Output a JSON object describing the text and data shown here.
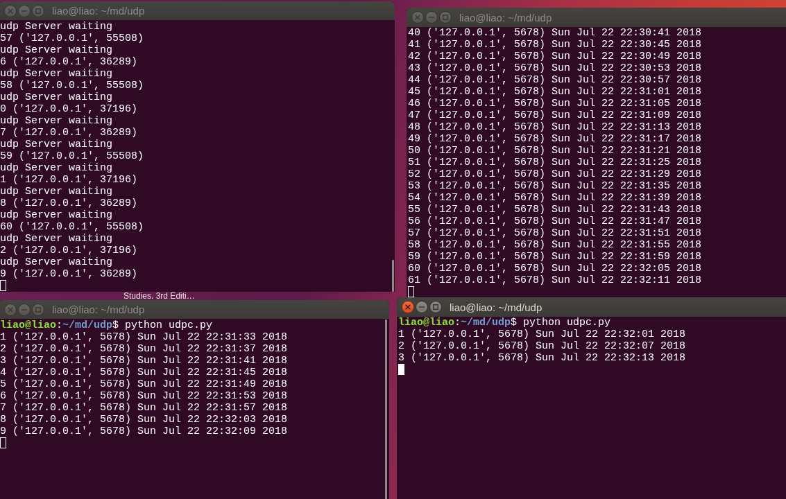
{
  "desktop": {
    "file_label": "Studies. 3rd Editi…"
  },
  "windows": [
    {
      "title": "liao@liao: ~/md/udp",
      "focused": false,
      "scrollbar": true,
      "lines": [
        {
          "kind": "output",
          "text": "udp Server waiting"
        },
        {
          "kind": "output",
          "text": "57 ('127.0.0.1', 55508)"
        },
        {
          "kind": "output",
          "text": "udp Server waiting"
        },
        {
          "kind": "output",
          "text": "6 ('127.0.0.1', 36289)"
        },
        {
          "kind": "output",
          "text": "udp Server waiting"
        },
        {
          "kind": "output",
          "text": "58 ('127.0.0.1', 55508)"
        },
        {
          "kind": "output",
          "text": "udp Server waiting"
        },
        {
          "kind": "output",
          "text": "0 ('127.0.0.1', 37196)"
        },
        {
          "kind": "output",
          "text": "udp Server waiting"
        },
        {
          "kind": "output",
          "text": "7 ('127.0.0.1', 36289)"
        },
        {
          "kind": "output",
          "text": "udp Server waiting"
        },
        {
          "kind": "output",
          "text": "59 ('127.0.0.1', 55508)"
        },
        {
          "kind": "output",
          "text": "udp Server waiting"
        },
        {
          "kind": "output",
          "text": "1 ('127.0.0.1', 37196)"
        },
        {
          "kind": "output",
          "text": "udp Server waiting"
        },
        {
          "kind": "output",
          "text": "8 ('127.0.0.1', 36289)"
        },
        {
          "kind": "output",
          "text": "udp Server waiting"
        },
        {
          "kind": "output",
          "text": "60 ('127.0.0.1', 55508)"
        },
        {
          "kind": "output",
          "text": "udp Server waiting"
        },
        {
          "kind": "output",
          "text": "2 ('127.0.0.1', 37196)"
        },
        {
          "kind": "output",
          "text": "udp Server waiting"
        },
        {
          "kind": "output",
          "text": "9 ('127.0.0.1', 36289)"
        }
      ]
    },
    {
      "title": "liao@liao: ~/md/udp",
      "focused": false,
      "scrollbar": false,
      "lines": [
        {
          "kind": "output",
          "text": "40 ('127.0.0.1', 5678) Sun Jul 22 22:30:41 2018"
        },
        {
          "kind": "output",
          "text": "41 ('127.0.0.1', 5678) Sun Jul 22 22:30:45 2018"
        },
        {
          "kind": "output",
          "text": "42 ('127.0.0.1', 5678) Sun Jul 22 22:30:49 2018"
        },
        {
          "kind": "output",
          "text": "43 ('127.0.0.1', 5678) Sun Jul 22 22:30:53 2018"
        },
        {
          "kind": "output",
          "text": "44 ('127.0.0.1', 5678) Sun Jul 22 22:30:57 2018"
        },
        {
          "kind": "output",
          "text": "45 ('127.0.0.1', 5678) Sun Jul 22 22:31:01 2018"
        },
        {
          "kind": "output",
          "text": "46 ('127.0.0.1', 5678) Sun Jul 22 22:31:05 2018"
        },
        {
          "kind": "output",
          "text": "47 ('127.0.0.1', 5678) Sun Jul 22 22:31:09 2018"
        },
        {
          "kind": "output",
          "text": "48 ('127.0.0.1', 5678) Sun Jul 22 22:31:13 2018"
        },
        {
          "kind": "output",
          "text": "49 ('127.0.0.1', 5678) Sun Jul 22 22:31:17 2018"
        },
        {
          "kind": "output",
          "text": "50 ('127.0.0.1', 5678) Sun Jul 22 22:31:21 2018"
        },
        {
          "kind": "output",
          "text": "51 ('127.0.0.1', 5678) Sun Jul 22 22:31:25 2018"
        },
        {
          "kind": "output",
          "text": "52 ('127.0.0.1', 5678) Sun Jul 22 22:31:29 2018"
        },
        {
          "kind": "output",
          "text": "53 ('127.0.0.1', 5678) Sun Jul 22 22:31:35 2018"
        },
        {
          "kind": "output",
          "text": "54 ('127.0.0.1', 5678) Sun Jul 22 22:31:39 2018"
        },
        {
          "kind": "output",
          "text": "55 ('127.0.0.1', 5678) Sun Jul 22 22:31:43 2018"
        },
        {
          "kind": "output",
          "text": "56 ('127.0.0.1', 5678) Sun Jul 22 22:31:47 2018"
        },
        {
          "kind": "output",
          "text": "57 ('127.0.0.1', 5678) Sun Jul 22 22:31:51 2018"
        },
        {
          "kind": "output",
          "text": "58 ('127.0.0.1', 5678) Sun Jul 22 22:31:55 2018"
        },
        {
          "kind": "output",
          "text": "59 ('127.0.0.1', 5678) Sun Jul 22 22:31:59 2018"
        },
        {
          "kind": "output",
          "text": "60 ('127.0.0.1', 5678) Sun Jul 22 22:32:05 2018"
        },
        {
          "kind": "output",
          "text": "61 ('127.0.0.1', 5678) Sun Jul 22 22:32:11 2018"
        }
      ]
    },
    {
      "title": "liao@liao: ~/md/udp",
      "focused": false,
      "scrollbar": true,
      "lines": [
        {
          "kind": "prompt",
          "segments": [
            {
              "kind": "user",
              "text": "liao@liao"
            },
            {
              "kind": "plain",
              "text": ":"
            },
            {
              "kind": "path",
              "text": "~/md/udp"
            },
            {
              "kind": "plain",
              "text": "$ python udpc.py"
            }
          ]
        },
        {
          "kind": "output",
          "text": "1 ('127.0.0.1', 5678) Sun Jul 22 22:31:33 2018"
        },
        {
          "kind": "output",
          "text": "2 ('127.0.0.1', 5678) Sun Jul 22 22:31:37 2018"
        },
        {
          "kind": "output",
          "text": "3 ('127.0.0.1', 5678) Sun Jul 22 22:31:41 2018"
        },
        {
          "kind": "output",
          "text": "4 ('127.0.0.1', 5678) Sun Jul 22 22:31:45 2018"
        },
        {
          "kind": "output",
          "text": "5 ('127.0.0.1', 5678) Sun Jul 22 22:31:49 2018"
        },
        {
          "kind": "output",
          "text": "6 ('127.0.0.1', 5678) Sun Jul 22 22:31:53 2018"
        },
        {
          "kind": "output",
          "text": "7 ('127.0.0.1', 5678) Sun Jul 22 22:31:57 2018"
        },
        {
          "kind": "output",
          "text": "8 ('127.0.0.1', 5678) Sun Jul 22 22:32:03 2018"
        },
        {
          "kind": "output",
          "text": "9 ('127.0.0.1', 5678) Sun Jul 22 22:32:09 2018"
        }
      ]
    },
    {
      "title": "liao@liao: ~/md/udp",
      "focused": true,
      "scrollbar": false,
      "lines": [
        {
          "kind": "prompt",
          "segments": [
            {
              "kind": "user",
              "text": "liao@liao"
            },
            {
              "kind": "plain",
              "text": ":"
            },
            {
              "kind": "path",
              "text": "~/md/udp"
            },
            {
              "kind": "plain",
              "text": "$ python udpc.py"
            }
          ]
        },
        {
          "kind": "output",
          "text": "1 ('127.0.0.1', 5678) Sun Jul 22 22:32:01 2018"
        },
        {
          "kind": "output",
          "text": "2 ('127.0.0.1', 5678) Sun Jul 22 22:32:07 2018"
        },
        {
          "kind": "output",
          "text": "3 ('127.0.0.1', 5678) Sun Jul 22 22:32:13 2018"
        }
      ]
    }
  ]
}
